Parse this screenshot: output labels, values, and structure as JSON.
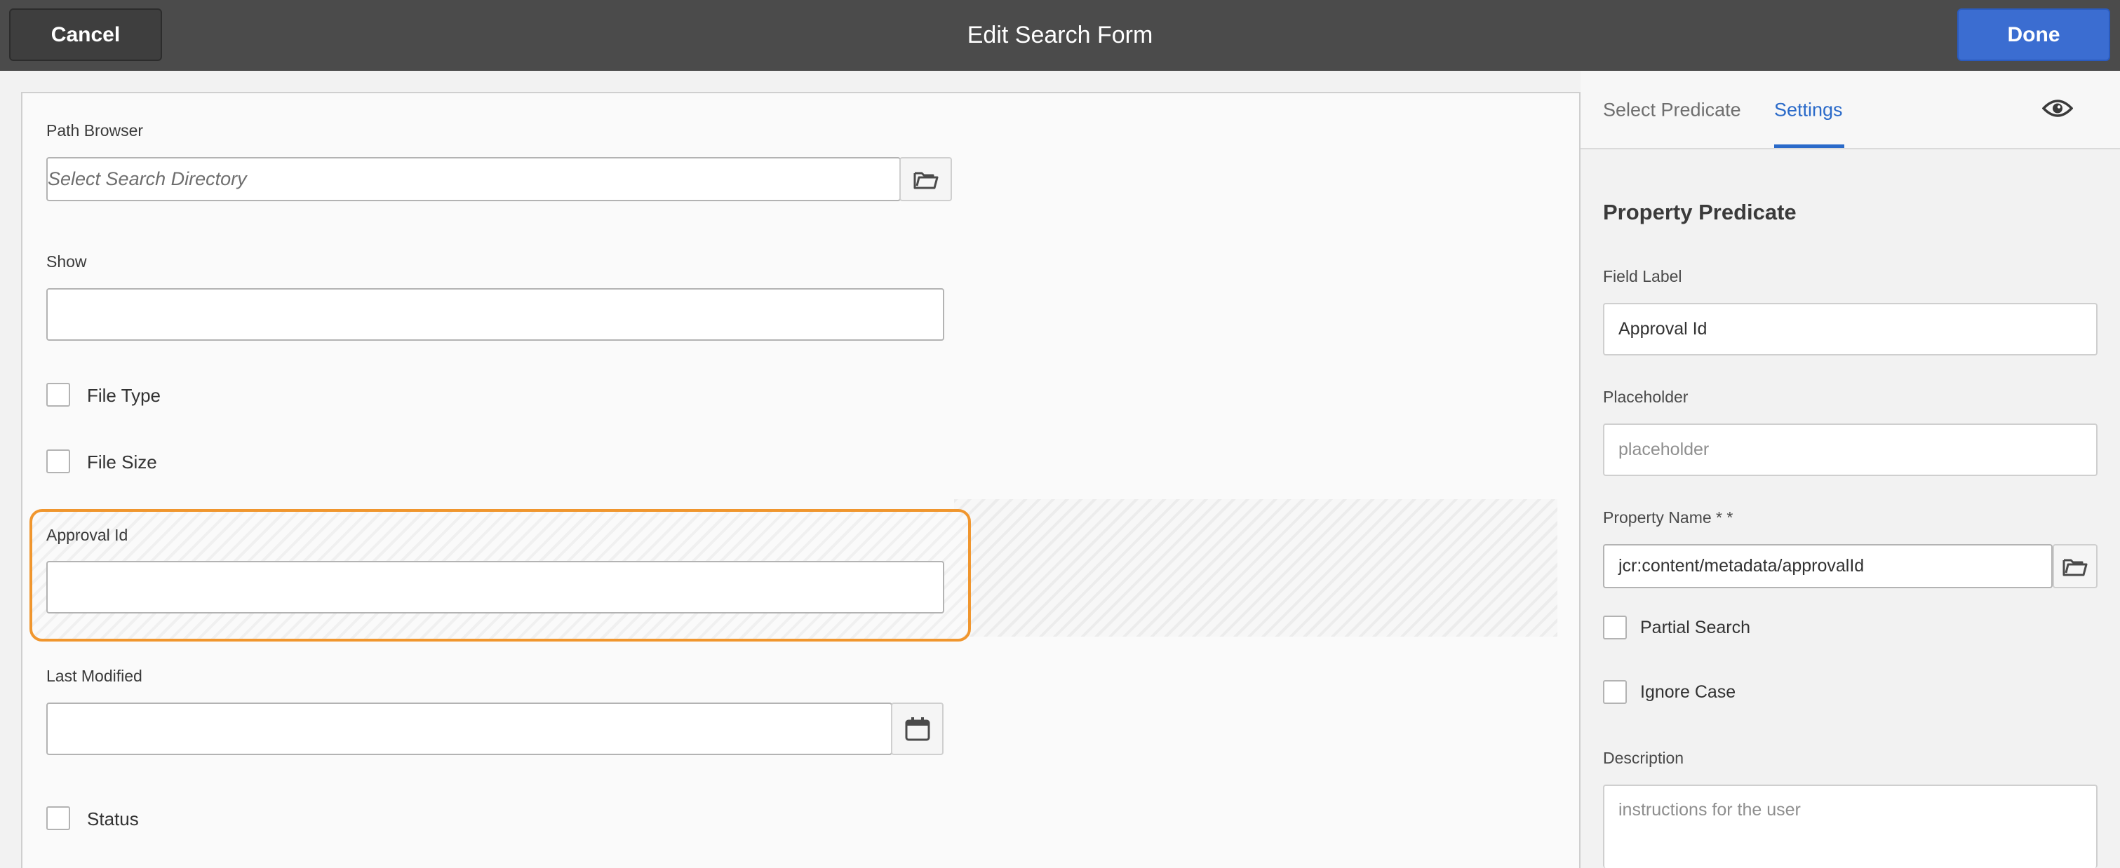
{
  "topbar": {
    "cancel_label": "Cancel",
    "title": "Edit Search Form",
    "done_label": "Done"
  },
  "form": {
    "path_browser": {
      "label": "Path Browser",
      "placeholder": "Select Search Directory"
    },
    "show": {
      "label": "Show",
      "value": ""
    },
    "file_type": {
      "label": "File Type",
      "checked": false
    },
    "file_size": {
      "label": "File Size",
      "checked": false
    },
    "approval_id": {
      "label": "Approval Id",
      "value": ""
    },
    "last_modified": {
      "label": "Last Modified",
      "value": ""
    },
    "status": {
      "label": "Status",
      "checked": false
    }
  },
  "panel": {
    "tabs": [
      {
        "label": "Select Predicate",
        "active": false
      },
      {
        "label": "Settings",
        "active": true
      }
    ],
    "heading": "Property Predicate",
    "field_label": {
      "label": "Field Label",
      "value": "Approval Id"
    },
    "placeholder": {
      "label": "Placeholder",
      "value": "placeholder"
    },
    "property_name": {
      "label": "Property Name * *",
      "value": "jcr:content/metadata/approvalId"
    },
    "partial_search": {
      "label": "Partial Search",
      "checked": false
    },
    "ignore_case": {
      "label": "Ignore Case",
      "checked": false
    },
    "description": {
      "label": "Description",
      "placeholder": "instructions for the user"
    }
  },
  "icons": {
    "folder": "folder-icon",
    "calendar": "calendar-icon",
    "eye": "eye-icon"
  },
  "colors": {
    "topbar": "#4b4b4b",
    "done_button": "#3b6dd1",
    "accent_tab": "#2a6ac9",
    "selected_outline": "#f0962e"
  }
}
